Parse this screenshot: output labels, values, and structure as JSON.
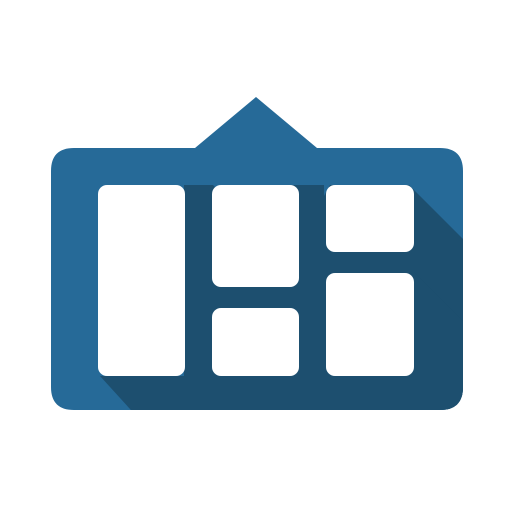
{
  "icon": {
    "name": "dashboard-tiles-icon",
    "colors": {
      "body": "#266a98",
      "shadow": "#1d4f6f",
      "tile": "#ffffff",
      "background": "#ffffff"
    }
  }
}
